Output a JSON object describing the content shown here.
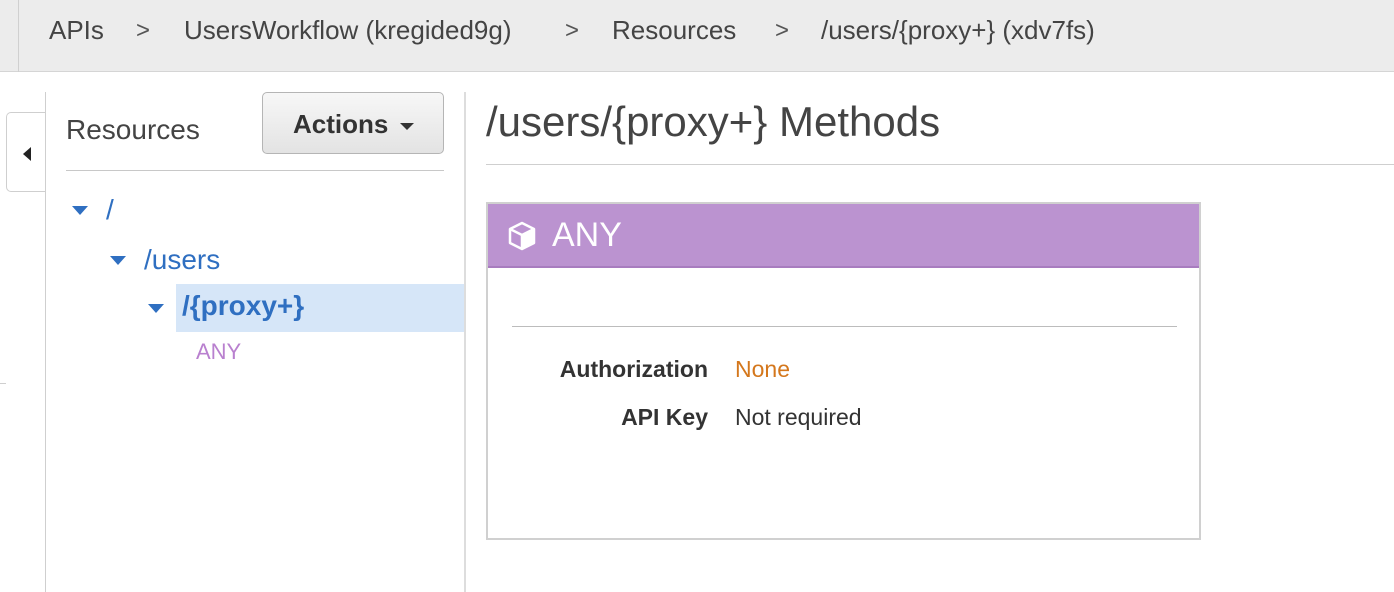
{
  "breadcrumb": {
    "items": [
      "APIs",
      "UsersWorkflow (kregided9g)",
      "Resources",
      "/users/{proxy+} (xdv7fs)"
    ],
    "separator": ">"
  },
  "sidebar": {
    "title": "Resources",
    "actions_label": "Actions",
    "tree": [
      {
        "label": "/",
        "expanded": true
      },
      {
        "label": "/users",
        "expanded": true
      },
      {
        "label": "/{proxy+}",
        "expanded": true,
        "selected": true
      }
    ],
    "methods": [
      "ANY"
    ],
    "collapse_icon": "caret-left-icon"
  },
  "main": {
    "title": "/users/{proxy+} Methods",
    "method": {
      "name": "ANY",
      "icon": "cube-icon",
      "color": "#bb93d0",
      "details": [
        {
          "key": "Authorization",
          "value": "None",
          "color": "#d4771c"
        },
        {
          "key": "API Key",
          "value": "Not required",
          "color": "#333333"
        }
      ]
    }
  },
  "colors": {
    "link": "#2f6fc1",
    "selected_bg": "#d6e6f8",
    "method_any": "#bb93d0"
  }
}
